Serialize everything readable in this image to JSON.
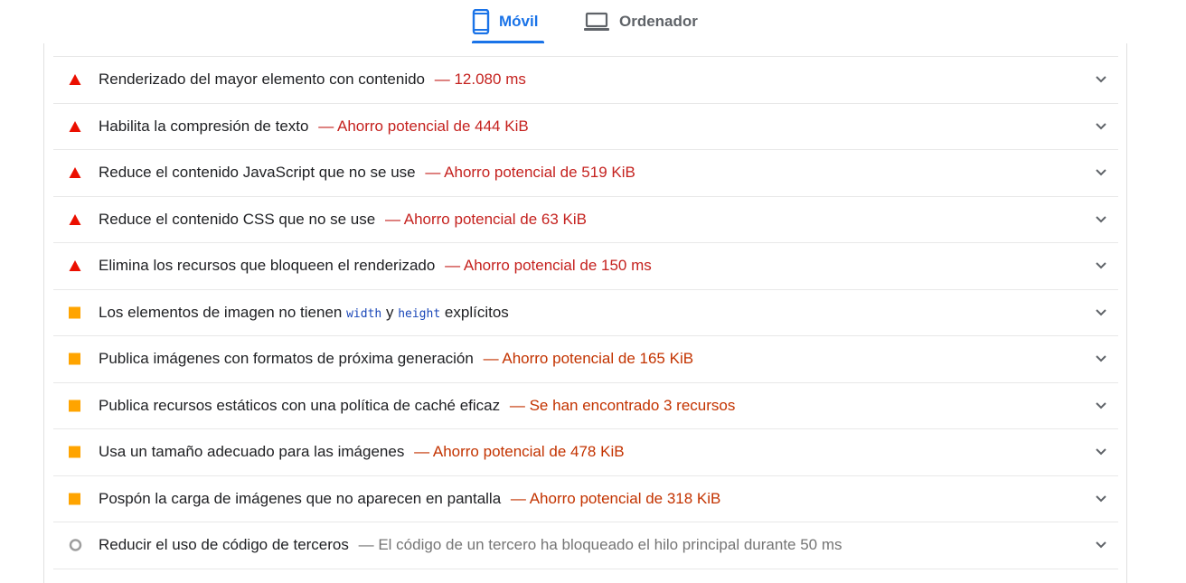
{
  "tabs": [
    {
      "label": "Móvil",
      "icon": "smartphone-icon",
      "active": true
    },
    {
      "label": "Ordenador",
      "icon": "laptop-icon",
      "active": false
    }
  ],
  "colors": {
    "accent": "#1a73e8",
    "fail": "#eb0f00",
    "average": "#ffa400",
    "info": "#9e9e9e"
  },
  "audits": [
    {
      "severity": "fail",
      "icon": "red-triangle-icon",
      "title": "Renderizado del mayor elemento con contenido",
      "detail": "— 12.080 ms"
    },
    {
      "severity": "fail",
      "icon": "red-triangle-icon",
      "title": "Habilita la compresión de texto",
      "detail": "— Ahorro potencial de 444 KiB"
    },
    {
      "severity": "fail",
      "icon": "red-triangle-icon",
      "title": "Reduce el contenido JavaScript que no se use",
      "detail": "— Ahorro potencial de 519 KiB"
    },
    {
      "severity": "fail",
      "icon": "red-triangle-icon",
      "title": "Reduce el contenido CSS que no se use",
      "detail": "— Ahorro potencial de 63 KiB"
    },
    {
      "severity": "fail",
      "icon": "red-triangle-icon",
      "title": "Elimina los recursos que bloqueen el renderizado",
      "detail": "— Ahorro potencial de 150 ms"
    },
    {
      "severity": "average",
      "icon": "orange-square-icon",
      "title_pre": "Los elementos de imagen no tienen",
      "code1": "width",
      "title_mid": "y",
      "code2": "height",
      "title_post": "explícitos"
    },
    {
      "severity": "average",
      "icon": "orange-square-icon",
      "title": "Publica imágenes con formatos de próxima generación",
      "detail": "— Ahorro potencial de 165 KiB"
    },
    {
      "severity": "average",
      "icon": "orange-square-icon",
      "title": "Publica recursos estáticos con una política de caché eficaz",
      "detail": "— Se han encontrado 3 recursos"
    },
    {
      "severity": "average",
      "icon": "orange-square-icon",
      "title": "Usa un tamaño adecuado para las imágenes",
      "detail": "— Ahorro potencial de 478 KiB"
    },
    {
      "severity": "average",
      "icon": "orange-square-icon",
      "title": "Pospón la carga de imágenes que no aparecen en pantalla",
      "detail": "— Ahorro potencial de 318 KiB"
    },
    {
      "severity": "info",
      "icon": "gray-circle-icon",
      "title": "Reducir el uso de código de terceros",
      "detail": "— El código de un tercero ha bloqueado el hilo principal durante 50 ms"
    }
  ]
}
